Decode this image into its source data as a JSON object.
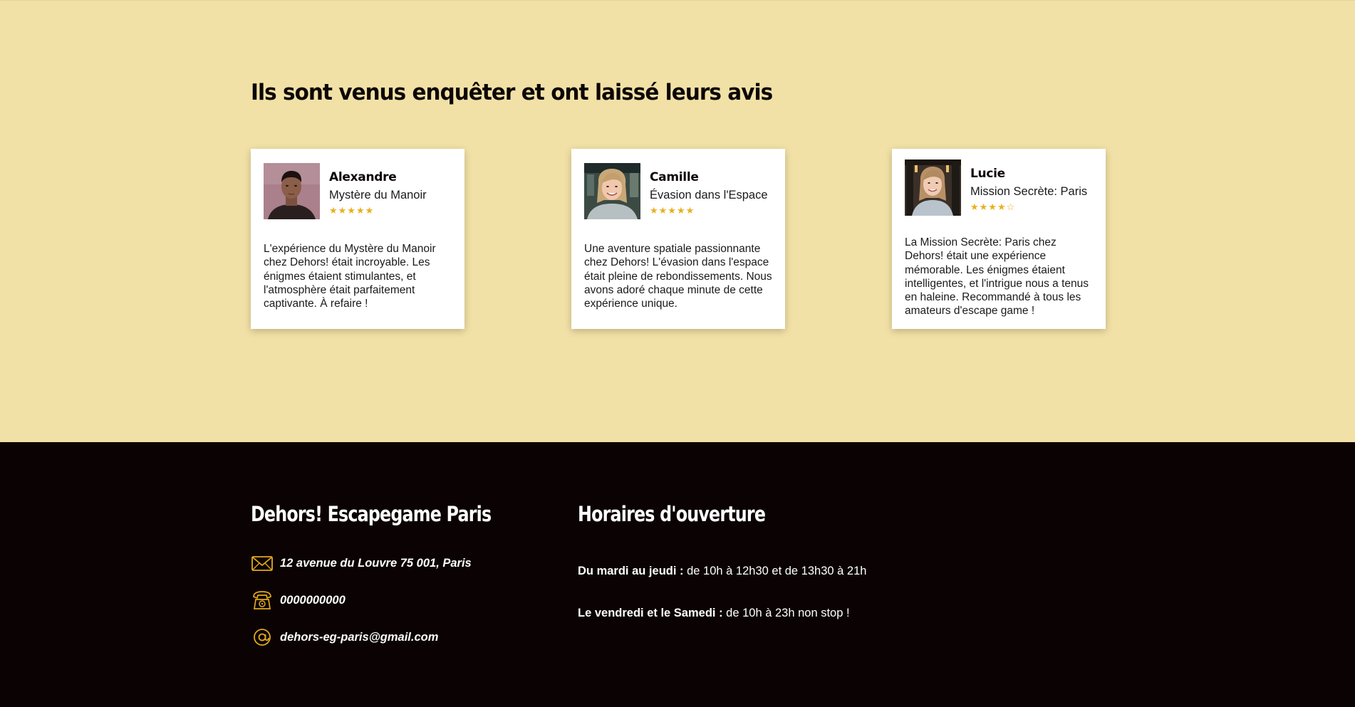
{
  "reviews": {
    "title": "Ils sont venus enquêter et ont laissé leurs avis",
    "cards": [
      {
        "name": "Alexandre",
        "game": "Mystère du Manoir",
        "stars": "★★★★★",
        "rating": 5,
        "text": "L'expérience du Mystère du Manoir chez Dehors! était incroyable. Les énigmes étaient stimulantes, et l'atmosphère était parfaitement captivante. À refaire !"
      },
      {
        "name": "Camille",
        "game": "Évasion dans l'Espace",
        "stars": "★★★★★",
        "rating": 5,
        "text": "Une aventure spatiale passionnante chez Dehors! L'évasion dans l'espace était pleine de rebondissements. Nous avons adoré chaque minute de cette expérience unique."
      },
      {
        "name": "Lucie",
        "game": "Mission Secrète: Paris",
        "stars": "★★★★☆",
        "rating": 4,
        "text": "La Mission Secrète: Paris chez Dehors! était une expérience mémorable. Les énigmes étaient intelligentes, et l'intrigue nous a tenus en haleine. Recommandé à tous les amateurs d'escape game !"
      }
    ]
  },
  "footer": {
    "company_title": "Dehors! Escapegame Paris",
    "address": "12 avenue du Louvre 75 001, Paris",
    "phone": "0000000000",
    "email": "dehors-eg-paris@gmail.com",
    "hours_title": "Horaires d'ouverture",
    "hours": [
      {
        "days": "Du mardi au jeudi :",
        "time": " de 10h à 12h30 et de 13h30 à 21h"
      },
      {
        "days": "Le vendredi et le Samedi :",
        "time": " de 10h à 23h non stop !"
      }
    ]
  },
  "colors": {
    "section_bg": "#f2e1a6",
    "footer_bg": "#0b0303",
    "star": "#e7b01e",
    "icon_gold": "#e2a91c"
  }
}
